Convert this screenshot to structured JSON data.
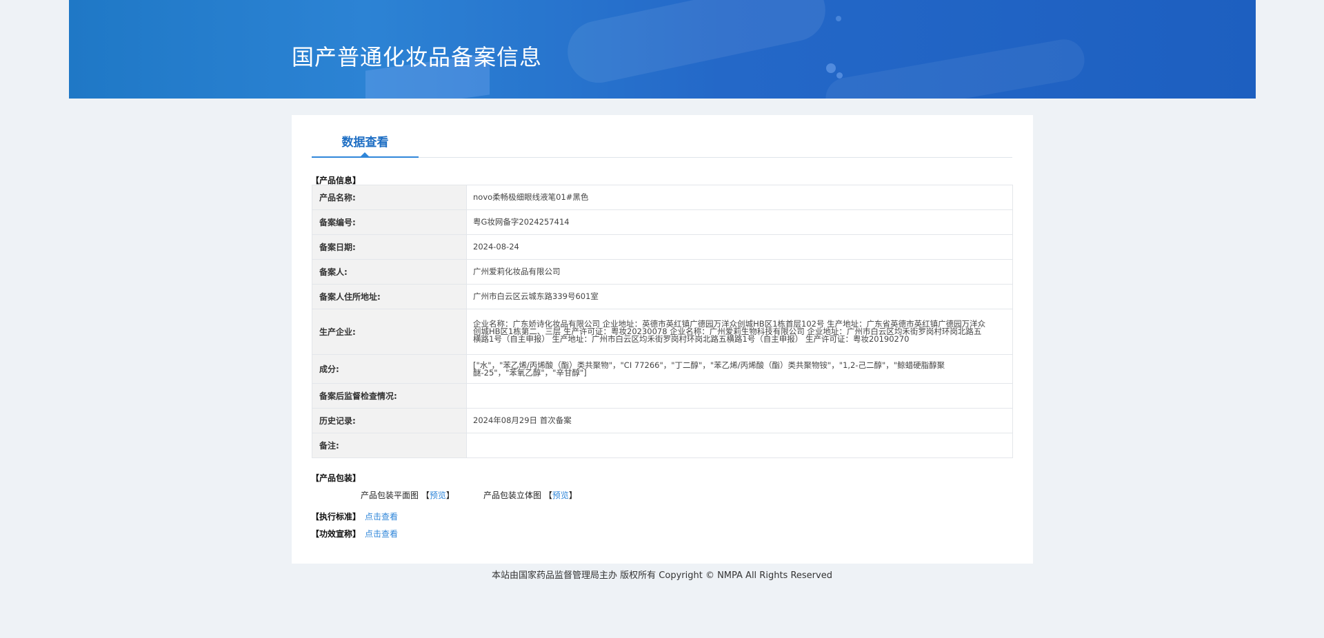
{
  "header": {
    "title": "国产普通化妆品备案信息"
  },
  "tabs": [
    {
      "label": "数据查看"
    }
  ],
  "product_info": {
    "section_label": "【产品信息】",
    "rows": [
      {
        "key": "产品名称:",
        "value": "novo柔畅极细眼线液笔01#黑色"
      },
      {
        "key": "备案编号:",
        "value": "粤G妆网备字2024257414"
      },
      {
        "key": "备案日期:",
        "value": "2024-08-24"
      },
      {
        "key": "备案人:",
        "value": "广州爱莉化妆品有限公司"
      },
      {
        "key": "备案人住所地址:",
        "value": "广州市白云区云城东路339号601室"
      },
      {
        "key": "生产企业:",
        "value": "企业名称：广东娇诗化妆品有限公司 企业地址：英德市英红镇广德园万洋众创城HB区1栋首层102号 生产地址：广东省英德市英红镇广德园万洋众创城HB区1栋第二、三层 生产许可证：粤妆20230078 企业名称：广州爱莉生物科技有限公司 企业地址：广州市白云区均禾街罗岗村环岗北路五横路1号（自主申报） 生产地址：广州市白云区均禾街罗岗村环岗北路五横路1号（自主申报） 生产许可证：粤妆20190270"
      },
      {
        "key": "成分:",
        "value": "[\"水\"，\"苯乙烯/丙烯酸（酯）类共聚物\"，\"CI 77266\"，\"丁二醇\"，\"苯乙烯/丙烯酸（酯）类共聚物铵\"，\"1,2-己二醇\"，\"鲸蜡硬脂醇聚醚-25\"，\"苯氧乙醇\"，\"辛甘醇\"]"
      },
      {
        "key": "备案后监督检查情况:",
        "value": ""
      },
      {
        "key": "历史记录:",
        "value": "2024年08月29日 首次备案"
      },
      {
        "key": "备注:",
        "value": ""
      }
    ]
  },
  "packaging": {
    "section_label": "【产品包装】",
    "flat_label": "产品包装平面图",
    "stereo_label": "产品包装立体图",
    "bracket_open": "【",
    "bracket_close": "】",
    "preview_label": "预览"
  },
  "standard": {
    "label": "【执行标准】",
    "link": "点击查看"
  },
  "efficacy": {
    "label": "【功效宣称】",
    "link": "点击查看"
  },
  "footer": {
    "text": "本站由国家药品监督管理局主办 版权所有 Copyright © NMPA All Rights Reserved"
  }
}
